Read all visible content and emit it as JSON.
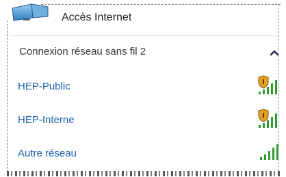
{
  "header": {
    "title": "Accès Internet",
    "icon": "network-monitor-icon"
  },
  "section": {
    "label": "Connexion réseau sans fil 2",
    "toggle_icon": "chevron-up-icon"
  },
  "networks": [
    {
      "name": "HEP-Public",
      "secured": true,
      "signal_bars": 5
    },
    {
      "name": "HEP-Interne",
      "secured": true,
      "signal_bars": 5
    },
    {
      "name": "Autre réseau",
      "secured": false,
      "signal_bars": 5
    }
  ],
  "colors": {
    "link": "#1a5fb4",
    "signal": "#2e9a2e",
    "shield": "#e0a020"
  }
}
